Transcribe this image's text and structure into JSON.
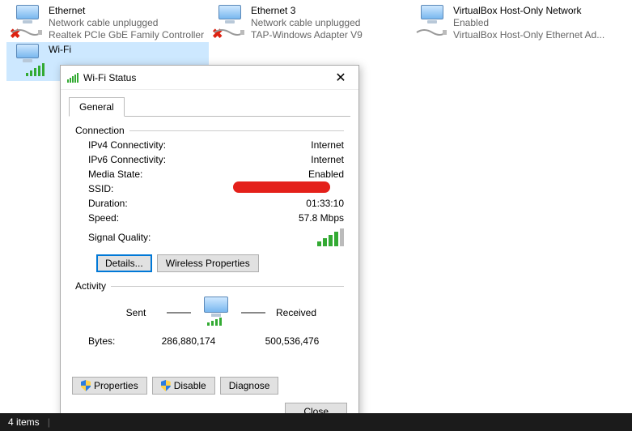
{
  "adapters": [
    {
      "name": "Ethernet",
      "status": "Network cable unplugged",
      "desc": "Realtek PCIe GbE Family Controller",
      "kind": "wired-unplugged"
    },
    {
      "name": "Ethernet 3",
      "status": "Network cable unplugged",
      "desc": "TAP-Windows Adapter V9",
      "kind": "wired-unplugged"
    },
    {
      "name": "VirtualBox Host-Only Network",
      "status": "Enabled",
      "desc": "VirtualBox Host-Only Ethernet Ad...",
      "kind": "wired"
    },
    {
      "name": "Wi-Fi",
      "status": "",
      "desc": "",
      "kind": "wifi",
      "selected": true
    }
  ],
  "dialog": {
    "title": "Wi-Fi Status",
    "tab": "General",
    "connection": {
      "group_label": "Connection",
      "ipv4_label": "IPv4 Connectivity:",
      "ipv4_value": "Internet",
      "ipv6_label": "IPv6 Connectivity:",
      "ipv6_value": "Internet",
      "media_label": "Media State:",
      "media_value": "Enabled",
      "ssid_label": "SSID:",
      "ssid_value": "",
      "duration_label": "Duration:",
      "duration_value": "01:33:10",
      "speed_label": "Speed:",
      "speed_value": "57.8 Mbps",
      "signal_label": "Signal Quality:"
    },
    "buttons": {
      "details": "Details...",
      "wireless": "Wireless Properties"
    },
    "activity": {
      "group_label": "Activity",
      "sent_label": "Sent",
      "received_label": "Received",
      "bytes_label": "Bytes:",
      "sent_value": "286,880,174",
      "received_value": "500,536,476"
    },
    "action_buttons": {
      "properties": "Properties",
      "disable": "Disable",
      "diagnose": "Diagnose"
    },
    "close": "Close"
  },
  "statusbar": {
    "items": "4 items"
  }
}
